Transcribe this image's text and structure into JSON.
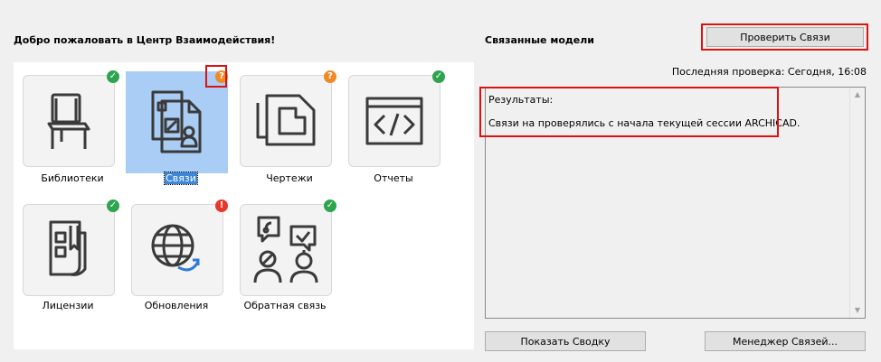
{
  "left_panel": {
    "title": "Добро пожаловать в Центр Взаимодействия!",
    "tiles": [
      {
        "label": "Библиотеки",
        "icon": "chair-icon",
        "status": "ok"
      },
      {
        "label": "Связи",
        "icon": "documents-icon",
        "status": "question",
        "selected": true
      },
      {
        "label": "Чертежи",
        "icon": "drawing-icon",
        "status": "question"
      },
      {
        "label": "Отчеты",
        "icon": "code-icon",
        "status": "ok"
      },
      {
        "label": "Лицензии",
        "icon": "license-icon",
        "status": "ok"
      },
      {
        "label": "Обновления",
        "icon": "globe-update-icon",
        "status": "error"
      },
      {
        "label": "Обратная связь",
        "icon": "feedback-icon",
        "status": "ok"
      }
    ],
    "badges": {
      "ok": "✓",
      "question": "?",
      "error": "!"
    }
  },
  "right_panel": {
    "title": "Связанные модели",
    "check_button": "Проверить Связи",
    "last_check": "Последняя проверка: Сегодня, 16:08",
    "results_header": "Результаты:",
    "results_message": "Связи на проверялись с начала текущей сессии ARCHICAD.",
    "summary_button": "Показать Сводку",
    "manager_button": "Менеджер Связей..."
  },
  "colors": {
    "ok": "#2ea44f",
    "question": "#f08a24",
    "error": "#e8382c",
    "selection": "#a9cdf4",
    "highlight_frame": "#e01010"
  }
}
